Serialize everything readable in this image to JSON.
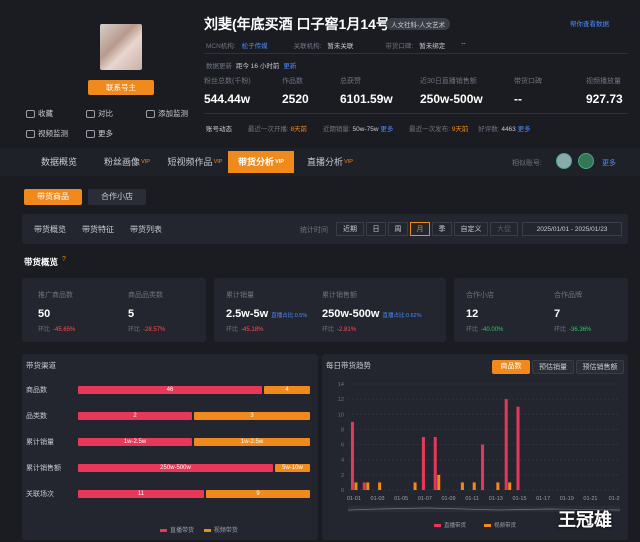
{
  "profile": {
    "name": "刘斐(年底买酒 口子窖1月14号...",
    "tag": "人文社科-人文艺术",
    "top_right_link": "帮你查看数据",
    "contact_label": "联系号主",
    "mcn_label": "MCN机构:",
    "mcn_value": "松子传媒",
    "platform_label": "关联机构:",
    "platform_value": "暂未关联",
    "shop_label": "带货口碑:",
    "shop_value": "暂未绑定",
    "extra_value": "--",
    "data_label": "数据更新",
    "data_note": "距今 16 小时前",
    "data_link": "更新",
    "side_actions": [
      "收藏",
      "对比",
      "添加监测",
      "视频监测",
      "更多"
    ]
  },
  "stats": [
    {
      "label": "粉丝总数(千粉)",
      "value": "544.44w"
    },
    {
      "label": "作品数",
      "value": "2520"
    },
    {
      "label": "总获赞",
      "value": "6101.59w"
    },
    {
      "label": "近30日直播销售额",
      "value": "250w-500w"
    },
    {
      "label": "带货口碑",
      "value": "--"
    },
    {
      "label": "视频播放量",
      "value": "927.73"
    }
  ],
  "activity": {
    "label": "账号动态",
    "live_label": "最近一次开播:",
    "live_value": "8天前",
    "sales_label": "近期销量:",
    "sales_value": "50w-75w",
    "more1": "更多",
    "video_label": "最近一次发布:",
    "video_value": "9天前",
    "likes_label": "好评数:",
    "likes_value": "4463",
    "more2": "更多"
  },
  "tabs": [
    {
      "label": "数据概览",
      "vip": ""
    },
    {
      "label": "粉丝画像",
      "vip": "VIP"
    },
    {
      "label": "短视频作品",
      "vip": "VIP"
    },
    {
      "label": "带货分析",
      "vip": "VIP"
    },
    {
      "label": "直播分析",
      "vip": "VIP"
    }
  ],
  "tabs_right": {
    "label": "相似账号:",
    "more": "更多"
  },
  "subtabs": [
    "带货商品",
    "合作小店"
  ],
  "subnav": [
    "带货概览",
    "带货特征",
    "带货列表"
  ],
  "range": {
    "label": "统计时间",
    "options": [
      "近期",
      "日",
      "周",
      "月",
      "季",
      "自定义",
      "大促"
    ],
    "selected": "月",
    "date": "2025/01/01 - 2025/01/23"
  },
  "overview_title": "带货概览",
  "kpis": [
    {
      "label": "推广商品数",
      "value": "50",
      "sub": "环比",
      "change": "-45.65%"
    },
    {
      "label": "商品品类数",
      "value": "5",
      "sub": "环比",
      "change": "-28.57%"
    },
    {
      "label": "累计销量",
      "value": "2.5w-5w",
      "sub": "环比",
      "change": "-45.18%",
      "extra": "直播占比:0.5%"
    },
    {
      "label": "累计销售额",
      "value": "250w-500w",
      "sub": "环比",
      "change": "-2.81%",
      "extra": "直播占比:0.62%"
    },
    {
      "label": "合作小店",
      "value": "12",
      "sub": "环比",
      "change": "-40.00%"
    },
    {
      "label": "合作品牌",
      "value": "7",
      "sub": "环比",
      "change": "-36.36%"
    }
  ],
  "channels": {
    "title": "带货渠道",
    "legend": [
      "直播带货",
      "视频带货"
    ],
    "rows": [
      {
        "label": "商品数",
        "live": "46",
        "video": "4",
        "live_frac": 0.8
      },
      {
        "label": "品类数",
        "live": "2",
        "video": "3",
        "live_frac": 0.5
      },
      {
        "label": "累计销量",
        "live": "1w-2.5w",
        "video": "1w-2.5w",
        "live_frac": 0.5
      },
      {
        "label": "累计销售额",
        "live": "250w-500w",
        "video": "5w-10w",
        "live_frac": 0.85
      },
      {
        "label": "关联场次",
        "live": "11",
        "video": "9",
        "live_frac": 0.55
      }
    ]
  },
  "chart_title": "每日带货趋势",
  "chart_buttons": [
    "商品数",
    "预估销量",
    "预估销售额"
  ],
  "chart_selected": "商品数",
  "chart_data": {
    "type": "bar",
    "categories": [
      "01-01",
      "01-02",
      "01-03",
      "01-04",
      "01-05",
      "01-06",
      "01-07",
      "01-08",
      "01-09",
      "01-10",
      "01-11",
      "01-12",
      "01-13",
      "01-14",
      "01-15",
      "01-16",
      "01-17",
      "01-18",
      "01-19",
      "01-20",
      "01-21",
      "01-22",
      "01-23"
    ],
    "tick_labels": [
      "01-01",
      "01-03",
      "01-05",
      "01-07",
      "01-09",
      "01-11",
      "01-13",
      "01-15",
      "01-17",
      "01-19",
      "01-21",
      "01-2"
    ],
    "series": [
      {
        "name": "直播带货",
        "color": "#e8385a",
        "values": [
          9,
          1,
          0,
          0,
          0,
          0,
          7,
          7,
          0,
          0,
          0,
          6,
          0,
          12,
          11,
          0,
          0,
          0,
          0,
          0,
          0,
          0,
          0
        ]
      },
      {
        "name": "视频带货",
        "color": "#f08a1c",
        "values": [
          1,
          1,
          1,
          0,
          0,
          1,
          0,
          2,
          0,
          1,
          1,
          0,
          1,
          1,
          0,
          0,
          0,
          0,
          0,
          0,
          0,
          0,
          0
        ]
      }
    ],
    "ylim": [
      0,
      14
    ],
    "yticks": [
      "0",
      "2",
      "4",
      "6",
      "8",
      "10",
      "12",
      "14"
    ],
    "grid": true,
    "legend": "bottom"
  },
  "watermark": "王冠雄"
}
